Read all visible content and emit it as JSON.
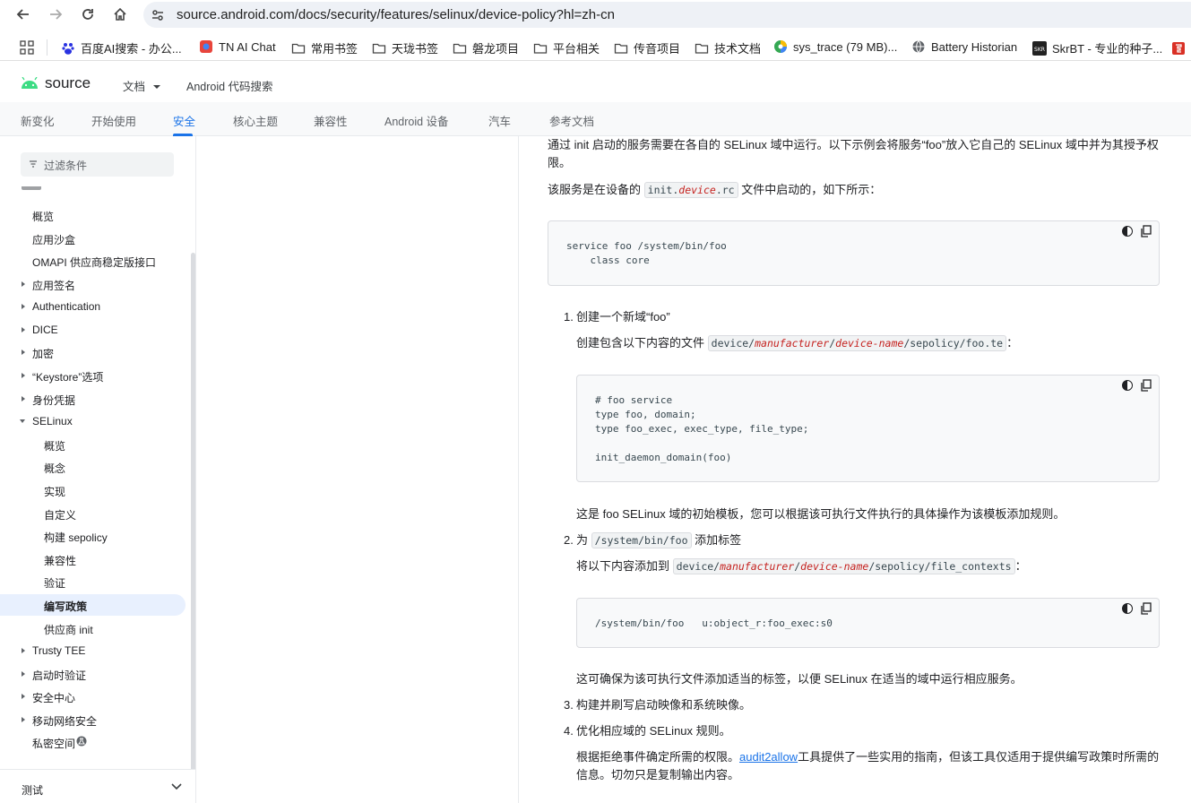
{
  "browser": {
    "url": "source.android.com/docs/security/features/selinux/device-policy?hl=zh-cn",
    "bookmarks": [
      {
        "label": "百度AI搜索 - 办公...",
        "icon": "baidu-icon"
      },
      {
        "label": "TN AI Chat",
        "icon": "app-icon"
      },
      {
        "label": "常用书签",
        "icon": "folder-icon"
      },
      {
        "label": "天珑书签",
        "icon": "folder-icon"
      },
      {
        "label": "磐龙项目",
        "icon": "folder-icon"
      },
      {
        "label": "平台相关",
        "icon": "folder-icon"
      },
      {
        "label": "传音项目",
        "icon": "folder-icon"
      },
      {
        "label": "技术文档",
        "icon": "folder-icon"
      },
      {
        "label": "sys_trace (79 MB)...",
        "icon": "perfetto-icon"
      },
      {
        "label": "Battery Historian",
        "icon": "globe-icon"
      },
      {
        "label": "SkrBT - 专业的种子...",
        "icon": "skr-icon"
      }
    ]
  },
  "site": {
    "logo": "source",
    "docs_menu": "文档",
    "code_search": "Android 代码搜索",
    "tabs": [
      "新变化",
      "开始使用",
      "安全",
      "核心主题",
      "兼容性",
      "Android 设备",
      "汽车",
      "参考文档"
    ],
    "active_tab": "安全"
  },
  "sidebar": {
    "filter_placeholder": "过滤条件",
    "items": [
      {
        "label": "概览"
      },
      {
        "label": "应用沙盒"
      },
      {
        "label": "OMAPI 供应商稳定版接口"
      },
      {
        "label": "应用签名"
      },
      {
        "label": "Authentication"
      },
      {
        "label": "DICE"
      },
      {
        "label": "加密"
      },
      {
        "label": "“Keystore”选项"
      },
      {
        "label": "身份凭据"
      },
      {
        "label": "SELinux"
      },
      {
        "label": "概览"
      },
      {
        "label": "概念"
      },
      {
        "label": "实现"
      },
      {
        "label": "自定义"
      },
      {
        "label": "构建 sepolicy"
      },
      {
        "label": "兼容性"
      },
      {
        "label": "验证"
      },
      {
        "label": "编写政策"
      },
      {
        "label": "供应商 init"
      },
      {
        "label": "Trusty TEE"
      },
      {
        "label": "启动时验证"
      },
      {
        "label": "安全中心"
      },
      {
        "label": "移动网络安全"
      },
      {
        "label": "私密空间"
      }
    ],
    "bottom_label": "测试"
  },
  "content": {
    "intro": "通过 init 启动的服务需要在各自的 SELinux 域中运行。以下示例会将服务“foo”放入它自己的 SELinux 域中并为其授予权限。",
    "service_started_pre": "该服务是在设备的",
    "service_started_code_a": "init.",
    "service_started_code_b": "device",
    "service_started_code_c": ".rc",
    "service_started_post": "文件中启动的，如下所示：",
    "code1": "service foo /system/bin/foo\n    class core",
    "step1_num": "1.",
    "step1_title": "创建一个新域“foo”",
    "step1_desc_pre": "创建包含以下内容的文件",
    "step1_path_a": "device/",
    "step1_path_b": "manufacturer",
    "step1_path_c": "/",
    "step1_path_d": "device-name",
    "step1_path_e": "/sepolicy/foo.te",
    "step1_desc_post": "：",
    "code2": "# foo service\ntype foo, domain;\ntype foo_exec, exec_type, file_type;\n\ninit_daemon_domain(foo)",
    "step1_note": "这是 foo SELinux 域的初始模板，您可以根据该可执行文件执行的具体操作为该模板添加规则。",
    "step2_num": "2.",
    "step2_pre": "为",
    "step2_code": "/system/bin/foo",
    "step2_post": "添加标签",
    "step2_desc_pre": "将以下内容添加到",
    "step2_path_a": "device/",
    "step2_path_b": "manufacturer",
    "step2_path_c": "/",
    "step2_path_d": "device-name",
    "step2_path_e": "/sepolicy/file_contexts",
    "step2_desc_post": "：",
    "code3": "/system/bin/foo   u:object_r:foo_exec:s0",
    "step2_note": "这可确保为该可执行文件添加适当的标签，以便 SELinux 在适当的域中运行相应服务。",
    "step3_num": "3.",
    "step3": "构建并刷写启动映像和系统映像。",
    "step4_num": "4.",
    "step4": "优化相应域的 SELinux 规则。",
    "step4_desc_pre": "根据拒绝事件确定所需的权限。",
    "step4_link": "audit2allow",
    "step4_desc_post": "工具提供了一些实用的指南，但该工具仅适用于提供编写政策时所需的",
    "step4_desc_line2": "信息。切勿只是复制输出内容。"
  }
}
